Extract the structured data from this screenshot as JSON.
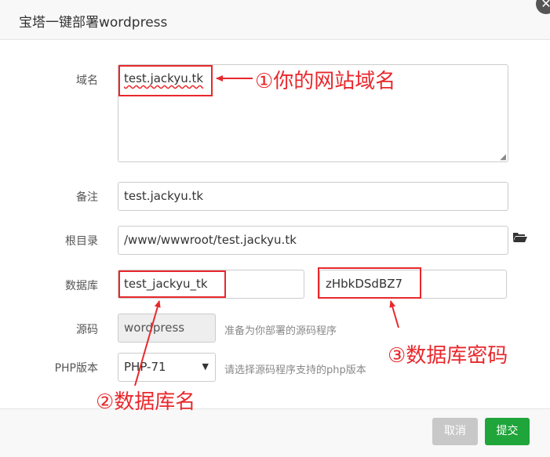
{
  "dialog": {
    "title": "宝塔一键部署wordpress",
    "close_symbol": "✕"
  },
  "form": {
    "domain_label": "域名",
    "domain_value": "test.jackyu.tk",
    "remark_label": "备注",
    "remark_value": "test.jackyu.tk",
    "root_label": "根目录",
    "root_value": "/www/wwwroot/test.jackyu.tk",
    "db_label": "数据库",
    "db_name_value": "test_jackyu_tk",
    "db_password_value": "zHbkDSdBZ7",
    "source_label": "源码",
    "source_value": "wordpress",
    "source_hint": "准备为你部署的源码程序",
    "php_label": "PHP版本",
    "php_value": "PHP-71",
    "php_hint": "请选择源码程序支持的php版本"
  },
  "annotations": {
    "a1": "①你的网站域名",
    "a2": "②数据库名",
    "a3": "③数据库密码",
    "color": "#e8282c"
  },
  "buttons": {
    "cancel": "取消",
    "submit": "提交"
  },
  "colors": {
    "submit_bg": "#20a53a",
    "cancel_bg": "#c8c8c8"
  }
}
